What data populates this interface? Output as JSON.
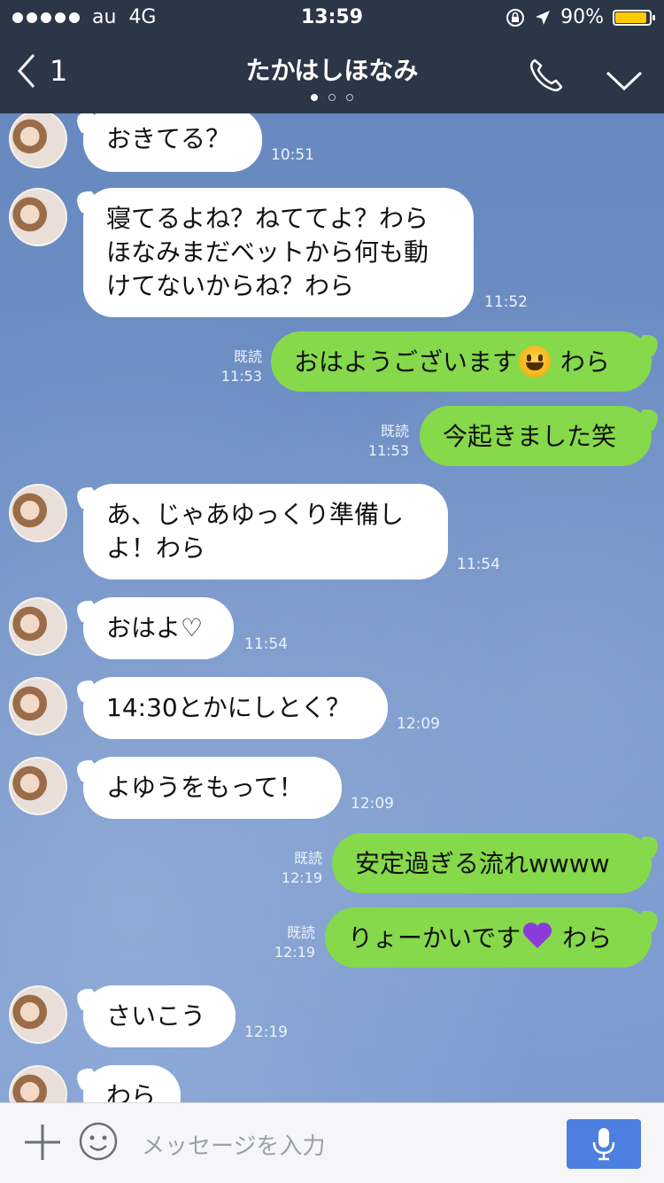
{
  "status": {
    "carrier": "au",
    "network": "4G",
    "time": "13:59",
    "battery": "90%"
  },
  "header": {
    "back_count": "1",
    "title": "たかはしほなみ",
    "page_dots": 3,
    "active_dot": 0,
    "icons": [
      "back-chevron-icon",
      "phone-icon",
      "chevron-down-icon"
    ]
  },
  "messages": [
    {
      "side": "in",
      "text": "おきてる？",
      "time": "10:51"
    },
    {
      "side": "in",
      "text": "寝てるよね？ねててよ？わらほなみまだベットから何も動けてないからね？わら",
      "lines": [
        "寝てるよね？ねててよ？わら",
        "ほなみまだベットから何も動",
        "けてないからね？わら"
      ],
      "time": "11:52"
    },
    {
      "side": "out",
      "text_before": "おはようございます",
      "emoji": "smile-emoji",
      "text_after": " わら",
      "read": "既読",
      "time": "11:53"
    },
    {
      "side": "out",
      "text": "今起きました笑",
      "read": "既読",
      "time": "11:53"
    },
    {
      "side": "in",
      "lines": [
        "あ、じゃあゆっくり準備し",
        "よ！わら"
      ],
      "time": "11:54"
    },
    {
      "side": "in",
      "text": "おはよ♡",
      "time": "11:54"
    },
    {
      "side": "in",
      "text": "14:30とかにしとく？",
      "time": "12:09"
    },
    {
      "side": "in",
      "text": "よゆうをもって！",
      "time": "12:09"
    },
    {
      "side": "out",
      "text": "安定過ぎる流れwwww",
      "read": "既読",
      "time": "12:19"
    },
    {
      "side": "out",
      "text_before": "りょーかいです",
      "emoji": "purple-heart-emoji",
      "text_after": " わら",
      "read": "既読",
      "time": "12:19"
    },
    {
      "side": "in",
      "text": "さいこう",
      "time": "12:19"
    },
    {
      "side": "in",
      "text": "わら"
    }
  ],
  "composer": {
    "placeholder": "メッセージを入力",
    "icons": [
      "plus-icon",
      "smiley-icon",
      "microphone-icon"
    ]
  },
  "colors": {
    "header_bg": "#2b3647",
    "chat_bg": "#6f90c2",
    "incoming_bubble": "#ffffff",
    "outgoing_bubble": "#86d94a",
    "battery": "#ffcc00",
    "mic_button": "#4c7fe0"
  }
}
